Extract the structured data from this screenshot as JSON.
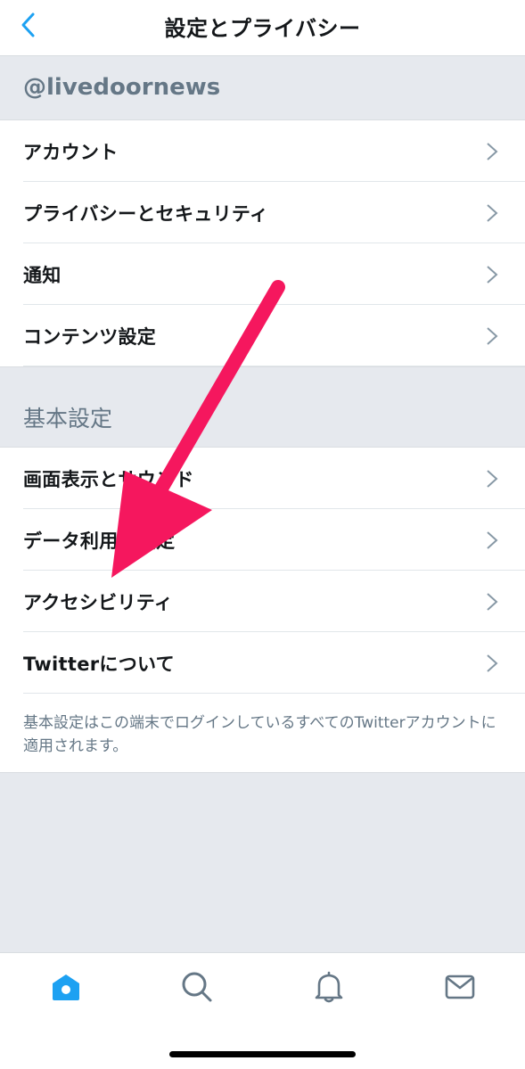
{
  "header": {
    "title": "設定とプライバシー",
    "back_icon": "chevron-left-icon"
  },
  "account_section": {
    "label": "@livedoornews",
    "items": [
      {
        "label": "アカウント"
      },
      {
        "label": "プライバシーとセキュリティ"
      },
      {
        "label": "通知"
      },
      {
        "label": "コンテンツ設定"
      }
    ]
  },
  "basic_section": {
    "label": "基本設定",
    "items": [
      {
        "label": "画面表示とサウンド"
      },
      {
        "label": "データ利用の設定"
      },
      {
        "label": "アクセシビリティ"
      },
      {
        "label": "Twitterについて"
      }
    ],
    "footnote": "基本設定はこの端末でログインしているすべてのTwitterアカウントに適用されます。"
  },
  "tab_bar": {
    "tabs": [
      {
        "icon": "home-icon",
        "active": true
      },
      {
        "icon": "search-icon",
        "active": false
      },
      {
        "icon": "bell-icon",
        "active": false
      },
      {
        "icon": "mail-icon",
        "active": false
      }
    ]
  },
  "colors": {
    "accent": "#1da1f2",
    "annotation_arrow": "#f5175e",
    "section_bg": "#e6e9ee",
    "secondary_text": "#657786",
    "chevron": "#8899a6"
  }
}
